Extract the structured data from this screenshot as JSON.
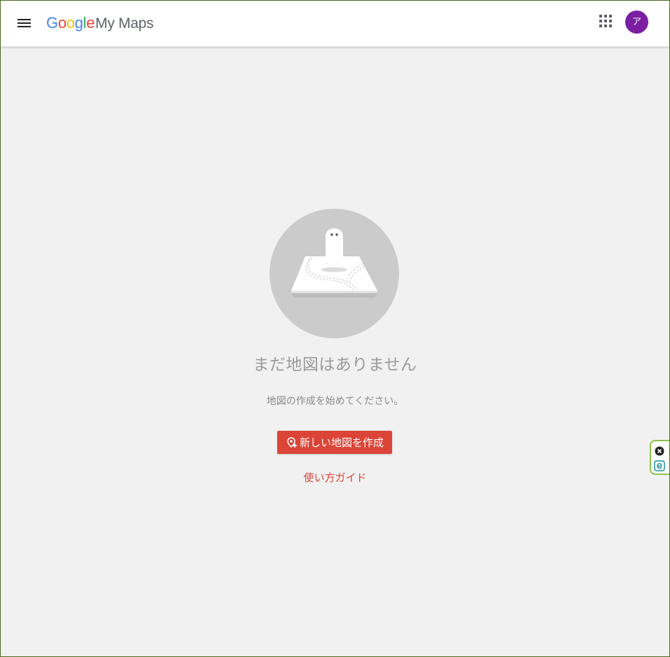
{
  "header": {
    "logo": {
      "google": [
        "G",
        "o",
        "o",
        "g",
        "l",
        "e"
      ],
      "product": "My Maps"
    },
    "avatar_initial": "ア"
  },
  "empty_state": {
    "title": "まだ地図はありません",
    "subtitle": "地図の作成を始めてください。",
    "create_button_label": "新しい地図を作成",
    "guide_link_label": "使い方ガイド"
  },
  "colors": {
    "brand_blue": "#4285F4",
    "brand_red": "#EA4335",
    "brand_yellow": "#FBBC05",
    "brand_green": "#34A853",
    "primary_button": "#db4437",
    "avatar": "#7b1fa2",
    "background": "#f1f1f1"
  },
  "icons": {
    "menu": "hamburger-menu-icon",
    "apps": "apps-grid-icon",
    "create": "add-map-icon",
    "widget_close": "close-circle-icon",
    "widget_extension": "letter-e-icon"
  }
}
